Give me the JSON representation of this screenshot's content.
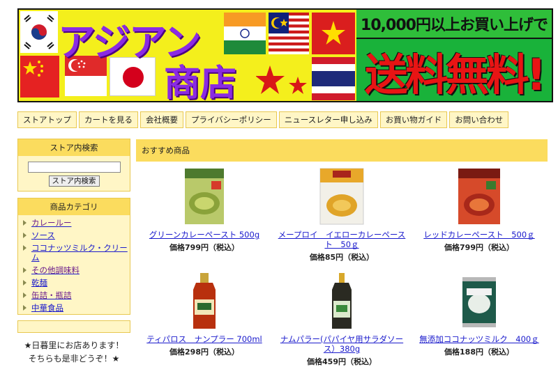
{
  "banner": {
    "title_line1": "アジアン",
    "title_line2": "商店",
    "promo_top": "10,000円以上お買い上げで",
    "promo_main": "送料無料!"
  },
  "nav": [
    {
      "label": "ストアトップ"
    },
    {
      "label": "カートを見る"
    },
    {
      "label": "会社概要"
    },
    {
      "label": "プライバシーポリシー"
    },
    {
      "label": "ニュースレター申し込み"
    },
    {
      "label": "お買い物ガイド"
    },
    {
      "label": "お問い合わせ"
    }
  ],
  "search": {
    "heading": "ストア内検索",
    "input_value": "",
    "button_label": "ストア内検索"
  },
  "categories": {
    "heading": "商品カテゴリ",
    "items": [
      {
        "label": "カレールー"
      },
      {
        "label": "ソース"
      },
      {
        "label": "ココナッツミルク・クリーム"
      },
      {
        "label": "その他調味料"
      },
      {
        "label": "乾麺"
      },
      {
        "label": "缶詰・瓶詰"
      },
      {
        "label": "中華食品"
      }
    ]
  },
  "sidebar_note": {
    "line1": "★日暮里にお店あります！",
    "line2": "そちらも是非どうぞ！★"
  },
  "recommended": {
    "heading": "おすすめ商品",
    "products": [
      {
        "name": "グリーンカレーペースト 500g",
        "price": "価格799円（税込）"
      },
      {
        "name": "メープロイ　イエローカレーペースト　50ｇ",
        "price": "価格85円（税込）"
      },
      {
        "name": "レッドカレーペースト　500ｇ",
        "price": "価格799円（税込）"
      },
      {
        "name": "ティパロス　ナンプラー 700ml",
        "price": "価格298円（税込）"
      },
      {
        "name": "ナムパラー(パパイヤ用サラダソース）380g",
        "price": "価格459円（税込）"
      },
      {
        "name": "無添加ココナッツミルク　400ｇ",
        "price": "価格188円（税込）"
      }
    ]
  },
  "colors": {
    "accent_yellow": "#fbdc5e",
    "panel_cream": "#fff6c6",
    "link_blue": "#1a1acc",
    "banner_yellow": "#f4ef1c",
    "banner_purple": "#8a2be2",
    "promo_green": "#19b23a",
    "promo_red": "#e81414"
  }
}
